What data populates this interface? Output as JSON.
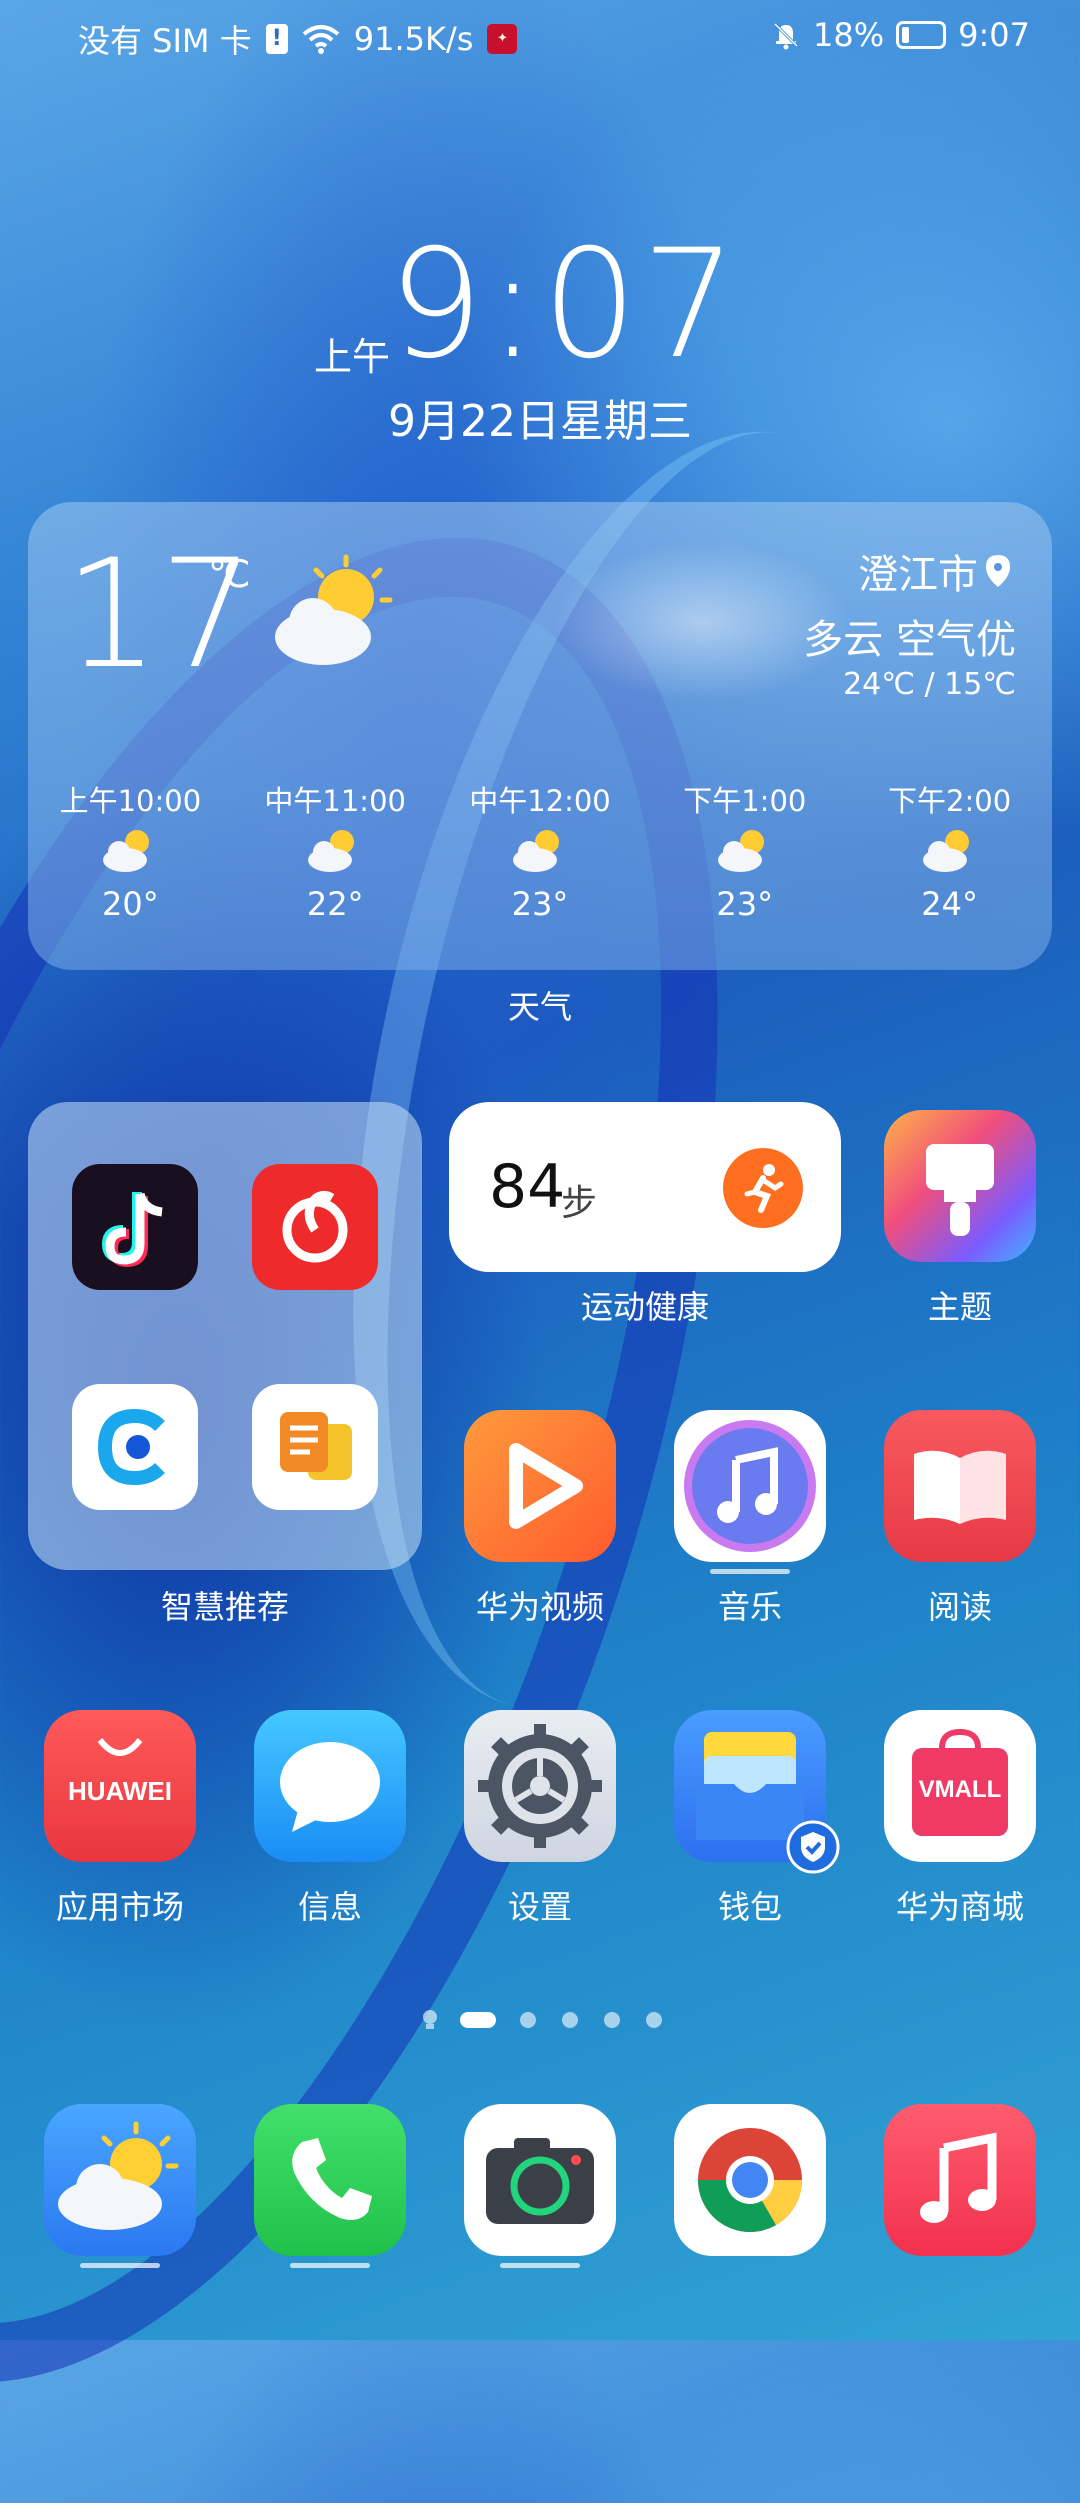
{
  "status_bar": {
    "carrier": "没有 SIM 卡",
    "sim_alert": "!",
    "net_speed": "91.5K/s",
    "battery_pct": "18%",
    "time": "9:07",
    "battery_level": 0.18
  },
  "clock": {
    "ampm": "上午",
    "time": "9:07",
    "date": "9月22日星期三"
  },
  "weather": {
    "temp": "17",
    "unit": "℃",
    "city": "澄江市",
    "condition": "多云 空气优",
    "range": "24℃ / 15℃",
    "hourly": [
      {
        "time": "上午10:00",
        "temp": "20°"
      },
      {
        "time": "中午11:00",
        "temp": "22°"
      },
      {
        "time": "中午12:00",
        "temp": "23°"
      },
      {
        "time": "下午1:00",
        "temp": "23°"
      },
      {
        "time": "下午2:00",
        "temp": "24°"
      }
    ],
    "label": "天气"
  },
  "folder": {
    "label": "智慧推荐"
  },
  "health": {
    "steps": "84",
    "unit": "步",
    "label": "运动健康"
  },
  "apps": {
    "theme": "主题",
    "video": "华为视频",
    "music": "音乐",
    "reader": "阅读",
    "appmarket": "应用市场",
    "appmarket_logo": "HUAWEI",
    "messages": "信息",
    "settings": "设置",
    "wallet": "钱包",
    "vmall": "华为商城",
    "vmall_logo": "VMALL"
  },
  "colors": {
    "accent_orange": "#ff6f1f",
    "market_red": "#e8363f",
    "phone_green": "#2bd14a",
    "music_red": "#f2314e"
  }
}
